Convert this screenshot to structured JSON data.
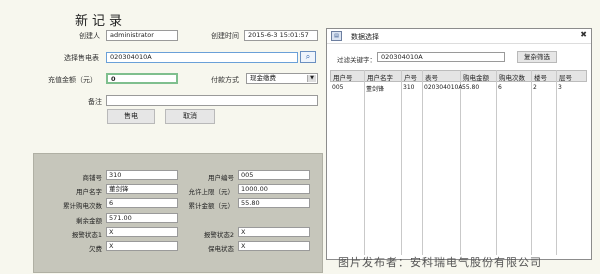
{
  "page": {
    "title": "新记录"
  },
  "form": {
    "creator_label": "创建人",
    "creator_value": "administrator",
    "created_time_label": "创建时间",
    "created_time_value": "2015-6-3 15:01:57",
    "meter_label": "选择售电表",
    "meter_value": "020304010A",
    "amount_label": "充值金额（元）",
    "amount_value": "0",
    "payment_label": "付款方式",
    "payment_value": "现金缴费",
    "note_label": "备注",
    "note_value": "",
    "sell_button": "售电",
    "cancel_button": "取消"
  },
  "info": {
    "shop_label": "商铺号",
    "shop_value": "310",
    "user_no_label": "用户编号",
    "user_no_value": "005",
    "user_name_label": "用户名字",
    "user_name_value": "董剑锋",
    "limit_label": "允许上限（元）",
    "limit_value": "1000.00",
    "buy_count_label": "累计购电次数",
    "buy_count_value": "6",
    "buy_amount_label": "累计金额（元）",
    "buy_amount_value": "55.80",
    "balance_label": "剩余金额",
    "balance_value": "571.00",
    "alarm1_label": "报警状态1",
    "alarm1_value": "X",
    "alarm2_label": "报警状态2",
    "alarm2_value": "X",
    "owe_label": "欠费",
    "owe_value": "X",
    "protect_label": "保电状态",
    "protect_value": "X"
  },
  "dialog": {
    "title": "数据选择",
    "filter_label": "过滤关键字：",
    "filter_value": "020304010A",
    "reset_button": "复杂筛选",
    "close": "✖",
    "columns": [
      "用户号",
      "用户名字",
      "户号",
      "表号",
      "购电金额",
      "购电次数",
      "楼号",
      "层号"
    ],
    "rows": [
      [
        "005",
        "董剑锋",
        "310",
        "020304010A",
        "55.80",
        "6",
        "2",
        "3"
      ]
    ]
  },
  "watermark": "图片发布者：安科瑞电气股份有限公司"
}
